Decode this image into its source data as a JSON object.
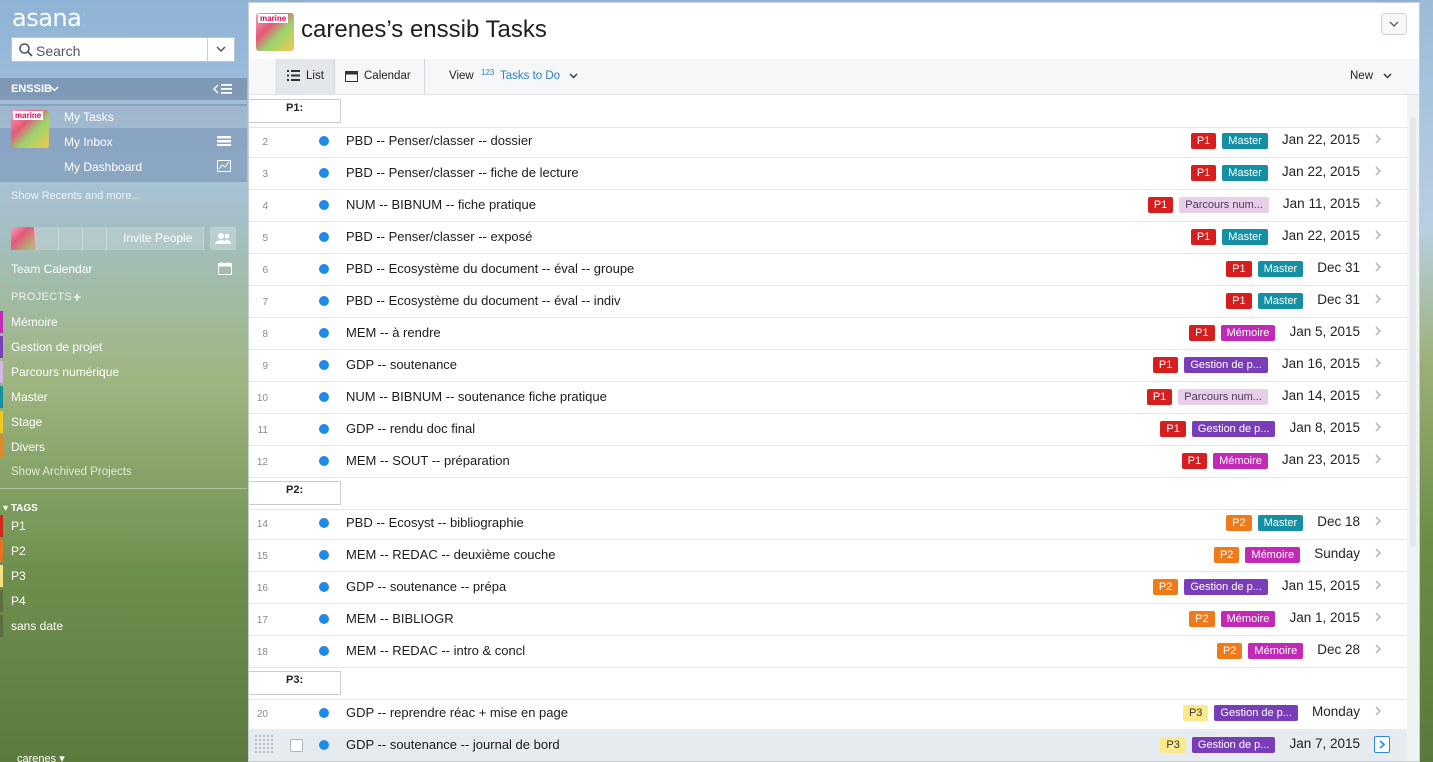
{
  "sidebar": {
    "logo": "asana",
    "search_placeholder": "Search",
    "org_name": "ENSSIB",
    "nav": [
      {
        "label": "My Tasks"
      },
      {
        "label": "My Inbox"
      },
      {
        "label": "My Dashboard"
      }
    ],
    "show_recents": "Show Recents and more...",
    "invite_people": "Invite People",
    "team_calendar": "Team Calendar",
    "projects_heading": "PROJECTS",
    "projects": [
      {
        "label": "Mémoire",
        "color": "#c02ab5"
      },
      {
        "label": "Gestion de projet",
        "color": "#7a3db8"
      },
      {
        "label": "Parcours numérique",
        "color": "#d8b6e3"
      },
      {
        "label": "Master",
        "color": "#1590a2"
      },
      {
        "label": "Stage",
        "color": "#f0c91c"
      },
      {
        "label": "Divers",
        "color": "#e0892a"
      }
    ],
    "show_archived": "Show Archived Projects",
    "tags_heading": "TAGS",
    "tags": [
      {
        "label": "P1",
        "color": "#d42a1d"
      },
      {
        "label": "P2",
        "color": "#e8731e"
      },
      {
        "label": "P3",
        "color": "#f7e27b"
      },
      {
        "label": "P4",
        "color": "#5c6f3f"
      },
      {
        "label": "sans date",
        "color": "#5c6f3f"
      }
    ],
    "user": "carenes"
  },
  "header": {
    "avatar_text": "marine",
    "title": "carenes’s enssib Tasks"
  },
  "toolbar": {
    "list_label": "List",
    "calendar_label": "Calendar",
    "view_label": "View",
    "view_sort_icon": "123",
    "view_value": "Tasks to Do",
    "new_label": "New"
  },
  "colors": {
    "P1": "#d51f1f",
    "P2": "#ee7b1b",
    "P3": "#fbe98a",
    "Master": "#1590a2",
    "Mémoire": "#c02ab5",
    "Gestion": "#7a3db8",
    "Parcours": "#e7cfe9",
    "task_dot": "#1f8ae6"
  },
  "sections": [
    {
      "label": "P1:"
    },
    {
      "label": "P2:"
    },
    {
      "label": "P3:"
    }
  ],
  "tasks": [
    {
      "num": "2",
      "name": "PBD -- Penser/classer -- dossier",
      "tags": [
        "P1",
        "Master"
      ],
      "date": "Jan 22, 2015"
    },
    {
      "num": "3",
      "name": "PBD -- Penser/classer -- fiche de lecture",
      "tags": [
        "P1",
        "Master"
      ],
      "date": "Jan 22, 2015"
    },
    {
      "num": "4",
      "name": "NUM -- BIBNUM -- fiche pratique",
      "tags": [
        "P1",
        "Parcours num..."
      ],
      "date": "Jan 11, 2015"
    },
    {
      "num": "5",
      "name": "PBD -- Penser/classer -- exposé",
      "tags": [
        "P1",
        "Master"
      ],
      "date": "Jan 22, 2015"
    },
    {
      "num": "6",
      "name": "PBD -- Ecosystème du document -- éval -- groupe",
      "tags": [
        "P1",
        "Master"
      ],
      "date": "Dec 31"
    },
    {
      "num": "7",
      "name": "PBD -- Ecosystème du document -- éval -- indiv",
      "tags": [
        "P1",
        "Master"
      ],
      "date": "Dec 31"
    },
    {
      "num": "8",
      "name": "MEM -- à rendre",
      "tags": [
        "P1",
        "Mémoire"
      ],
      "date": "Jan 5, 2015"
    },
    {
      "num": "9",
      "name": "GDP -- soutenance",
      "tags": [
        "P1",
        "Gestion de p..."
      ],
      "date": "Jan 16, 2015"
    },
    {
      "num": "10",
      "name": "NUM -- BIBNUM -- soutenance fiche pratique",
      "tags": [
        "P1",
        "Parcours num..."
      ],
      "date": "Jan 14, 2015"
    },
    {
      "num": "11",
      "name": "GDP -- rendu doc final",
      "tags": [
        "P1",
        "Gestion de p..."
      ],
      "date": "Jan 8, 2015"
    },
    {
      "num": "12",
      "name": "MEM -- SOUT -- préparation",
      "tags": [
        "P1",
        "Mémoire"
      ],
      "date": "Jan 23, 2015"
    },
    {
      "num": "14",
      "name": "PBD -- Ecosyst -- bibliographie",
      "tags": [
        "P2",
        "Master"
      ],
      "date": "Dec 18"
    },
    {
      "num": "15",
      "name": "MEM -- REDAC -- deuxième couche",
      "tags": [
        "P2",
        "Mémoire"
      ],
      "date": "Sunday"
    },
    {
      "num": "16",
      "name": "GDP -- soutenance -- prépa",
      "tags": [
        "P2",
        "Gestion de p..."
      ],
      "date": "Jan 15, 2015"
    },
    {
      "num": "17",
      "name": "MEM -- BIBLIOGR",
      "tags": [
        "P2",
        "Mémoire"
      ],
      "date": "Jan 1, 2015"
    },
    {
      "num": "18",
      "name": "MEM -- REDAC -- intro & concl",
      "tags": [
        "P2",
        "Mémoire"
      ],
      "date": "Dec 28"
    },
    {
      "num": "20",
      "name": "GDP -- reprendre réac + mise en page",
      "tags": [
        "P3",
        "Gestion de p..."
      ],
      "date": "Monday"
    },
    {
      "num": "",
      "name": "GDP -- soutenance -- journal de bord",
      "tags": [
        "P3",
        "Gestion de p..."
      ],
      "date": "Jan 7, 2015"
    }
  ]
}
